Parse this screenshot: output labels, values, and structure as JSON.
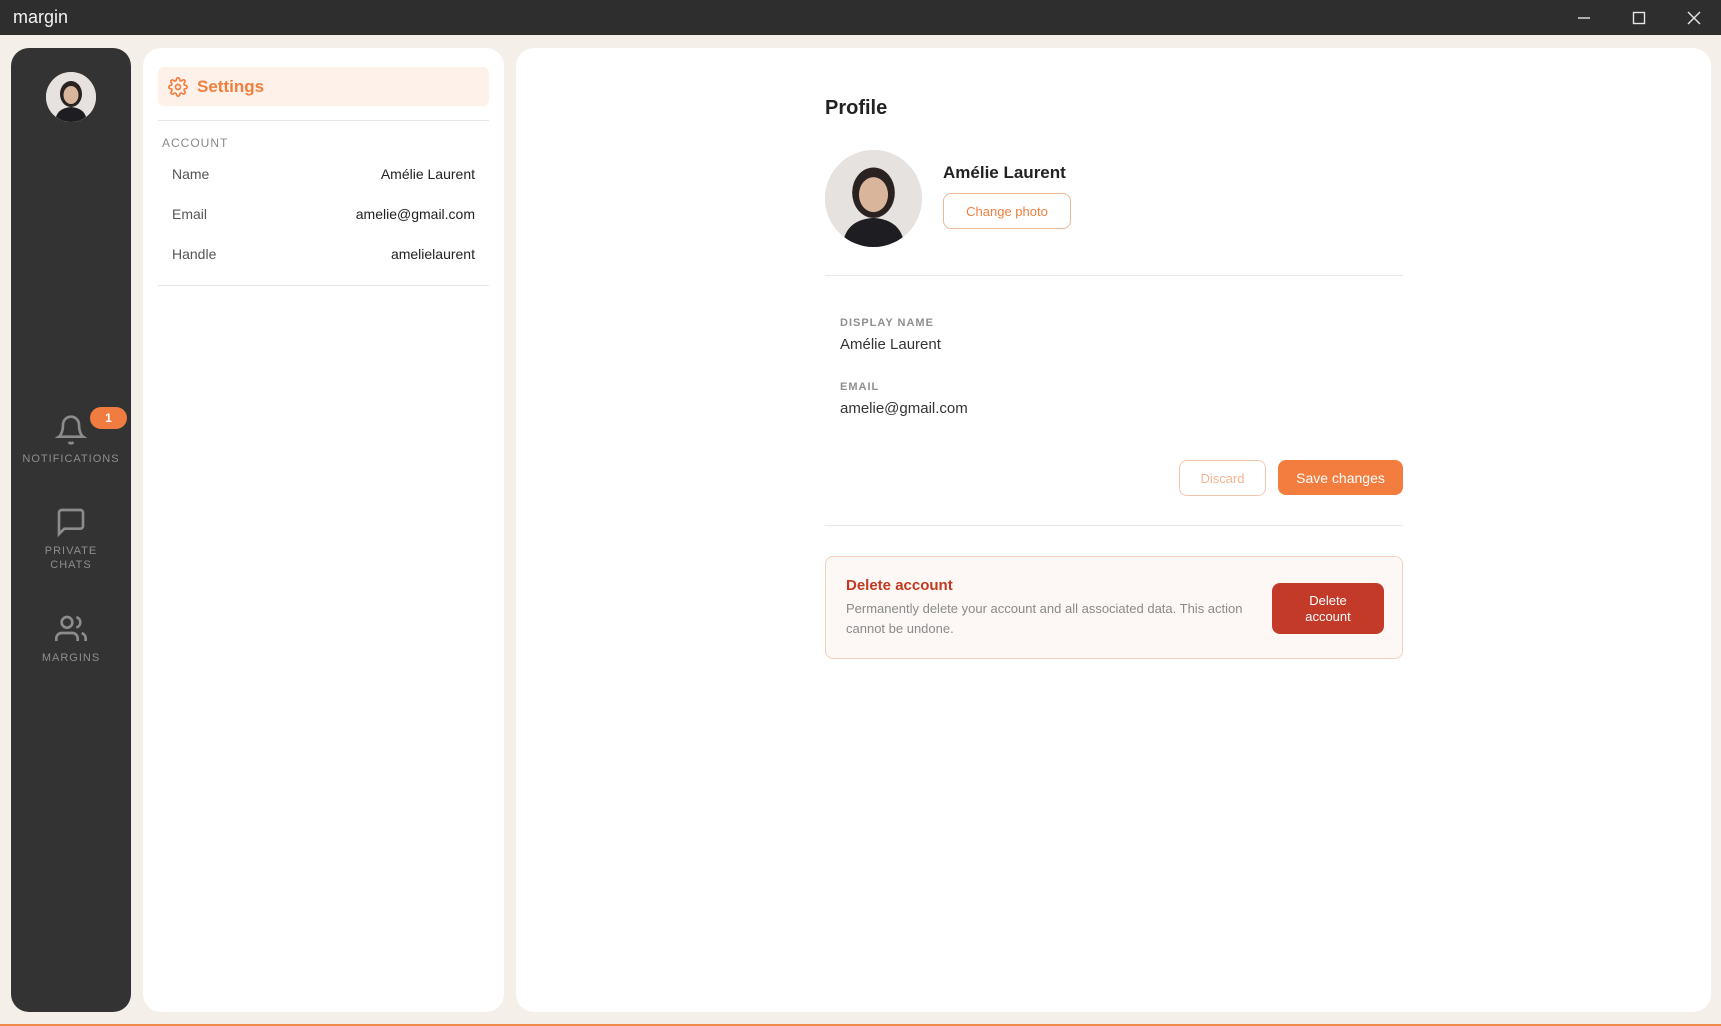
{
  "window": {
    "title": "margin",
    "controls": [
      "minimize-icon",
      "maximize-icon",
      "close-icon"
    ]
  },
  "rail": {
    "avatar_icon": "user-avatar",
    "nav": [
      {
        "label": "NOTIFICATIONS",
        "icon": "bell-icon",
        "badge": "1"
      },
      {
        "label": "PRIVATE\nCHATS",
        "icon": "chat-bubble-icon"
      },
      {
        "label": "MARGINS",
        "icon": "users-icon"
      }
    ]
  },
  "settings": {
    "title": "Settings",
    "icon": "gear-icon",
    "section_label": "ACCOUNT",
    "rows": [
      {
        "key": "Name",
        "value": "Amélie Laurent"
      },
      {
        "key": "Email",
        "value": "amelie@gmail.com"
      },
      {
        "key": "Handle",
        "value": "amelielaurent"
      }
    ]
  },
  "profile": {
    "title": "Profile",
    "name": "Amélie Laurent",
    "change_photo_label": "Change photo",
    "fields": [
      {
        "label": "DISPLAY NAME",
        "value": "Amélie Laurent"
      },
      {
        "label": "EMAIL",
        "value": "amelie@gmail.com"
      }
    ],
    "discard_label": "Discard",
    "save_label": "Save changes",
    "danger": {
      "title": "Delete account",
      "description": "Permanently delete your account and all associated data. This action cannot be undone.",
      "button_label": "Delete\naccount"
    }
  },
  "colors": {
    "accent": "#f27d3e",
    "danger": "#c43a28",
    "rail": "#333333",
    "titlebar": "#2e2e2e"
  }
}
